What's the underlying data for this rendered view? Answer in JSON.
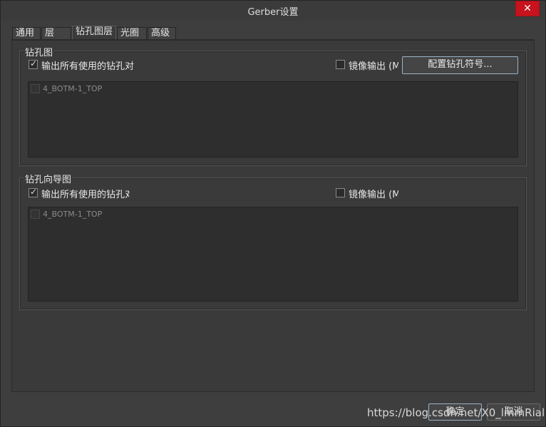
{
  "window": {
    "title": "Gerber设置",
    "close_symbol": "✕"
  },
  "tabs": [
    {
      "label": "通用"
    },
    {
      "label": "层"
    },
    {
      "label": "钻孔图层"
    },
    {
      "label": "光圈"
    },
    {
      "label": "高级"
    }
  ],
  "drill_drawing": {
    "group_title": "钻孔图",
    "plot_all_used_pairs": {
      "label": "输出所有使用的钻孔对",
      "checked": true
    },
    "mirror_output": {
      "label": "镜像输出 (M",
      "checked": false
    },
    "config_symbols_button": "配置钻孔符号...",
    "layer_pairs": [
      {
        "label": "4_BOTM-1_TOP",
        "checked": false
      }
    ]
  },
  "drill_guide": {
    "group_title": "钻孔向导图",
    "plot_all_used_pairs": {
      "label": "输出所有使用的钻孔对",
      "checked": true
    },
    "mirror_output": {
      "label": "镜像输出 (M",
      "checked": false
    },
    "layer_pairs": [
      {
        "label": "4_BOTM-1_TOP",
        "checked": false
      }
    ]
  },
  "footer": {
    "ok_label": "确定",
    "cancel_label": "取消"
  },
  "watermark": "https://blog.csdn.net/X0_lmmRial"
}
